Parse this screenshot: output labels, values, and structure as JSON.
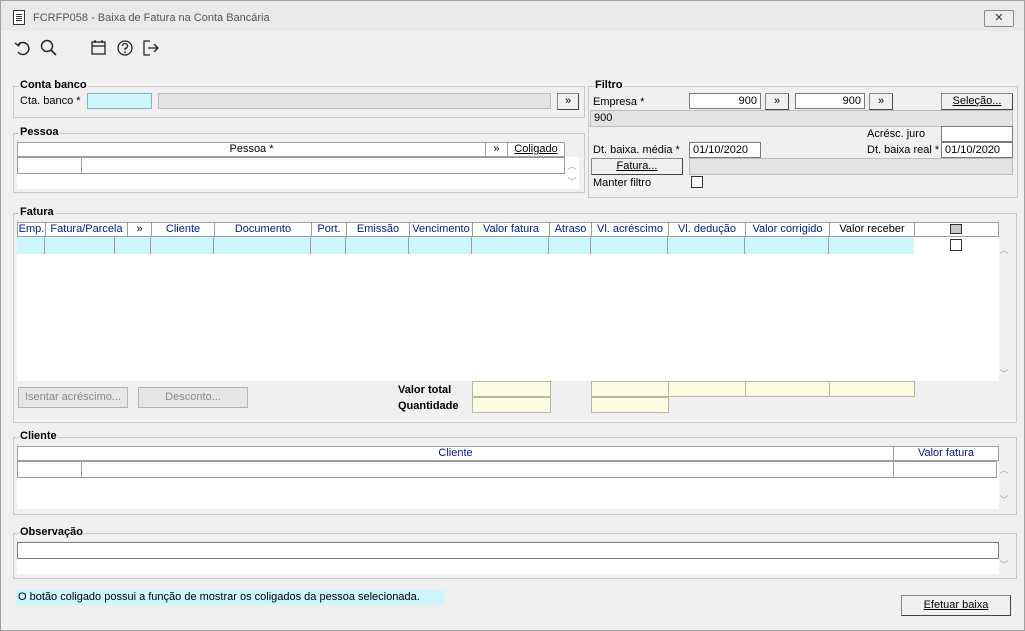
{
  "window": {
    "title": "FCRFP058 - Baixa de Fatura na Conta Bancária"
  },
  "toolbar": {
    "icons": [
      "undo-icon",
      "search-icon",
      "calendar-icon",
      "help-icon",
      "exit-icon"
    ]
  },
  "conta_banco": {
    "label": "Conta banco",
    "cta_label": "Cta. banco *",
    "cta_value": "",
    "desc_value": "",
    "more": "»"
  },
  "filtro": {
    "label": "Filtro",
    "empresa_label": "Empresa *",
    "empresa_from": "900",
    "empresa_to": "900",
    "more": "»",
    "selecao": "Seleção...",
    "empresa_desc": "900",
    "acresc_label": "Acrésc. juro",
    "acresc_value": "",
    "dt_media_label": "Dt. baixa. média *",
    "dt_media_value": "01/10/2020",
    "dt_real_label": "Dt. baixa real *",
    "dt_real_value": "01/10/2020",
    "fatura_btn": "Fatura...",
    "manter_label": "Manter filtro"
  },
  "pessoa": {
    "label": "Pessoa",
    "col_pessoa": "Pessoa *",
    "more": "»",
    "coligado": "Coligado"
  },
  "fatura": {
    "label": "Fatura",
    "columns": [
      "Emp.",
      "Fatura/Parcela",
      "»",
      "Cliente",
      "Documento",
      "Port.",
      "Emissão",
      "Vencimento",
      "Valor fatura",
      "Atraso",
      "Vl. acréscimo",
      "Vl. dedução",
      "Valor corrigido",
      "Valor receber"
    ],
    "isentar": "Isentar acréscimo...",
    "desconto": "Desconto...",
    "valor_total_label": "Valor total",
    "quantidade_label": "Quantidade"
  },
  "cliente": {
    "label": "Cliente",
    "col_cliente": "Cliente",
    "col_valor": "Valor fatura"
  },
  "observacao": {
    "label": "Observação",
    "value": ""
  },
  "status": {
    "hint": "O botão coligado possui a função de mostrar os coligados da pessoa selecionada."
  },
  "actions": {
    "efetuar": "Efetuar baixa"
  }
}
